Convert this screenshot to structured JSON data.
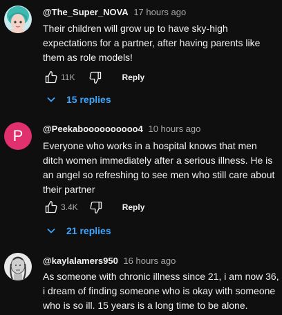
{
  "comments": [
    {
      "author": "@The_Super_NOVA",
      "time": "17 hours ago",
      "text": "Their children will grow up to have sky-high expectations for a partner, after having parents like them as role models!",
      "likes": "11K",
      "reply_label": "Reply",
      "replies_label": "15 replies",
      "avatar_icon": "teal-hair-avatar"
    },
    {
      "author": "@Peekaboooooooooo4",
      "time": "10 hours ago",
      "text": "Everyone who works in a hospital knows that men ditch women immediately after a serious illness. He is an angel so refreshing to see men who still care about their partner",
      "likes": "3.4K",
      "reply_label": "Reply",
      "replies_label": "21 replies",
      "avatar_letter": "P",
      "avatar_color": "#e0306e"
    },
    {
      "author": "@kaylalamers950",
      "time": "16 hours ago",
      "text": "As someone with chronic illness since 21, i am now 36, i dream of finding someone who is okay with someone who is so ill. 15 years is a long time to be alone.",
      "avatar_icon": "sketch-portrait-avatar"
    }
  ],
  "colors": {
    "background": "#0f0f0f",
    "text": "#f1f1f1",
    "muted": "#aaaaaa",
    "link": "#3ea6ff"
  }
}
